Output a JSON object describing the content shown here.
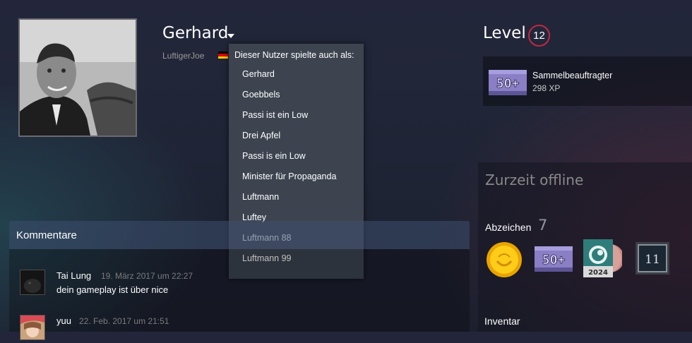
{
  "profile": {
    "persona_name": "Gerhard",
    "real_name": "LuftigerJoe"
  },
  "aliases_dropdown": {
    "title": "Dieser Nutzer spielte auch als:",
    "items": [
      "Gerhard",
      "Goebbels",
      "Passi ist ein Low",
      "Drei Apfel",
      "Passi is ein Low",
      "Minister für Propaganda",
      "Luftmann",
      "Luftey",
      "Luftmann 88",
      "Luftmann 99"
    ]
  },
  "level": {
    "label": "Level",
    "value": "12"
  },
  "favorite_badge": {
    "icon_text": "50+",
    "name": "Sammelbeauftragter",
    "xp": "298 XP"
  },
  "status": {
    "text": "Zurzeit offline"
  },
  "badges": {
    "label": "Abzeichen",
    "count": "7",
    "items": [
      {
        "icon": "gold-medal-icon"
      },
      {
        "icon": "50-plus-icon",
        "text": "50+"
      },
      {
        "icon": "steam-2024-icon",
        "text": "2024"
      },
      {
        "icon": "years-of-service-icon",
        "text": "11"
      }
    ]
  },
  "inventory": {
    "label": "Inventar"
  },
  "comments": {
    "header": "Kommentare",
    "items": [
      {
        "author": "Tai Lung",
        "time": "19. März 2017 um 22:27",
        "text": "dein gameplay ist über nice"
      },
      {
        "author": "yuu",
        "time": "22. Feb. 2017 um 21:51",
        "text": ""
      }
    ]
  },
  "colors": {
    "level_ring": "#c02942",
    "dropdown_bg": "#3d4450",
    "flag": [
      "#000000",
      "#dd0000",
      "#ffce00"
    ]
  }
}
